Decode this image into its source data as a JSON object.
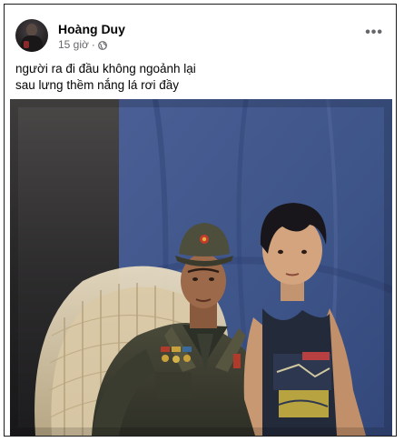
{
  "post": {
    "author": "Hoàng Duy",
    "time": "15 giờ",
    "separator": "·",
    "privacy_icon": "globe-icon",
    "more_icon": "more-options-icon",
    "more_label": "•••",
    "caption_lines": [
      "người ra đi đầu không ngoảnh lại",
      "sau lưng thềm nắng lá rơi đầy"
    ]
  },
  "colors": {
    "text_primary": "#050505",
    "text_secondary": "#65676b",
    "backdrop_blue": "#3d5488"
  }
}
